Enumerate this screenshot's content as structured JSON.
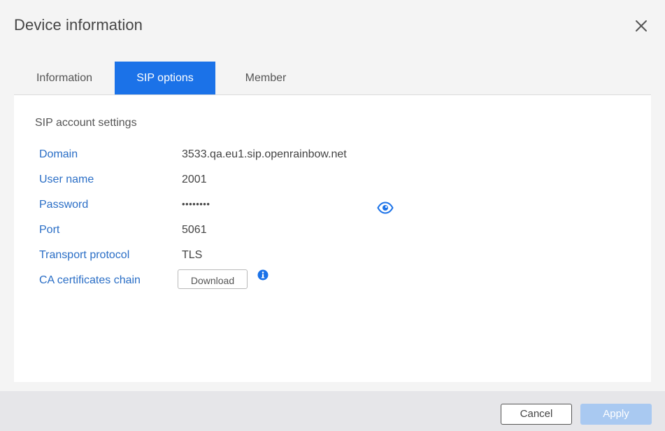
{
  "dialog": {
    "title": "Device information",
    "close_icon": "close-icon"
  },
  "tabs": [
    {
      "label": "Information",
      "active": false
    },
    {
      "label": "SIP options",
      "active": true
    },
    {
      "label": "Member",
      "active": false
    }
  ],
  "sip": {
    "section_title": "SIP account settings",
    "rows": [
      {
        "label": "Domain",
        "value": "3533.qa.eu1.sip.openrainbow.net"
      },
      {
        "label": "User name",
        "value": "2001"
      },
      {
        "label": "Password",
        "value": "••••••••"
      },
      {
        "label": "Port",
        "value": "5061"
      },
      {
        "label": "Transport protocol",
        "value": "TLS"
      },
      {
        "label": "CA certificates chain",
        "value": ""
      }
    ],
    "show_password_icon": "eye-icon",
    "download_label": "Download",
    "info_icon": "info-icon"
  },
  "footer": {
    "cancel_label": "Cancel",
    "apply_label": "Apply"
  },
  "colors": {
    "accent": "#1b72e8",
    "label_blue": "#2a6ec6",
    "apply_disabled": "#a9c9f1"
  }
}
